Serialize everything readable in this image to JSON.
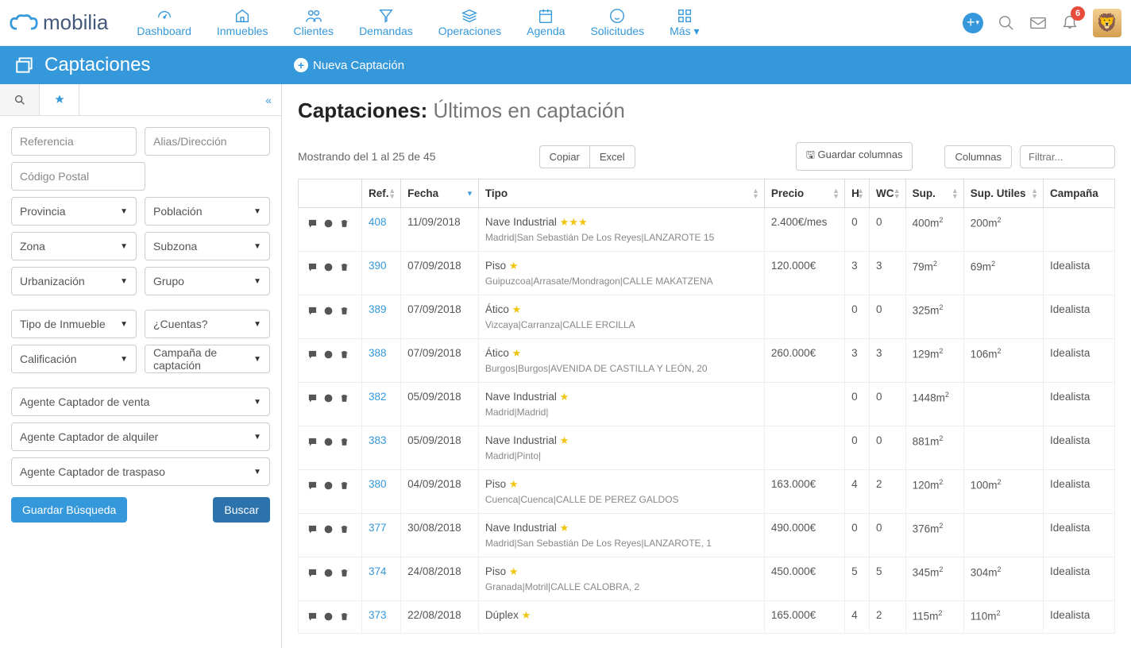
{
  "brand": "mobilia",
  "nav": {
    "items": [
      "Dashboard",
      "Inmuebles",
      "Clientes",
      "Demandas",
      "Operaciones",
      "Agenda",
      "Solicitudes",
      "Más"
    ],
    "badge": "6"
  },
  "bluebar": {
    "title": "Captaciones",
    "action": "Nueva Captación"
  },
  "filters": {
    "referencia": "Referencia",
    "alias": "Alias/Dirección",
    "cp": "Código Postal",
    "provincia": "Provincia",
    "poblacion": "Población",
    "zona": "Zona",
    "subzona": "Subzona",
    "urbanizacion": "Urbanización",
    "grupo": "Grupo",
    "tipo": "Tipo de Inmueble",
    "cuentas": "¿Cuentas?",
    "calificacion": "Calificación",
    "campana": "Campaña de captación",
    "agente_venta": "Agente Captador de venta",
    "agente_alquiler": "Agente Captador de alquiler",
    "agente_traspaso": "Agente Captador de traspaso",
    "guardar": "Guardar Búsqueda",
    "buscar": "Buscar"
  },
  "page": {
    "title_bold": "Captaciones:",
    "title_light": " Últimos en captación",
    "showing": "Mostrando del 1 al 25 de 45",
    "copiar": "Copiar",
    "excel": "Excel",
    "guardar_col": "Guardar columnas",
    "columnas": "Columnas",
    "filtrar": "Filtrar..."
  },
  "table": {
    "headers": {
      "ref": "Ref.",
      "fecha": "Fecha",
      "tipo": "Tipo",
      "precio": "Precio",
      "h": "H",
      "wc": "WC",
      "sup": "Sup.",
      "suputil": "Sup. Utiles",
      "campana": "Campaña"
    },
    "rows": [
      {
        "ref": "408",
        "fecha": "11/09/2018",
        "tipo": "Nave Industrial",
        "stars": 3,
        "sub": "Madrid|San Sebastián De Los Reyes|LANZAROTE 15",
        "precio": "2.400€/mes",
        "h": "0",
        "wc": "0",
        "sup": "400m",
        "suputil": "200m",
        "campana": ""
      },
      {
        "ref": "390",
        "fecha": "07/09/2018",
        "tipo": "Piso",
        "stars": 1,
        "sub": "Guipuzcoa|Arrasate/Mondragon|CALLE MAKATZENA",
        "precio": "120.000€",
        "h": "3",
        "wc": "3",
        "sup": "79m",
        "suputil": "69m",
        "campana": "Idealista"
      },
      {
        "ref": "389",
        "fecha": "07/09/2018",
        "tipo": "Ático",
        "stars": 1,
        "sub": "Vizcaya|Carranza|CALLE ERCILLA",
        "precio": "",
        "h": "0",
        "wc": "0",
        "sup": "325m",
        "suputil": "",
        "campana": "Idealista"
      },
      {
        "ref": "388",
        "fecha": "07/09/2018",
        "tipo": "Ático",
        "stars": 1,
        "sub": "Burgos|Burgos|AVENIDA DE CASTILLA Y LEÓN, 20",
        "precio": "260.000€",
        "h": "3",
        "wc": "3",
        "sup": "129m",
        "suputil": "106m",
        "campana": "Idealista"
      },
      {
        "ref": "382",
        "fecha": "05/09/2018",
        "tipo": "Nave Industrial",
        "stars": 1,
        "sub": "Madrid|Madrid|",
        "precio": "",
        "h": "0",
        "wc": "0",
        "sup": "1448m",
        "suputil": "",
        "campana": "Idealista"
      },
      {
        "ref": "383",
        "fecha": "05/09/2018",
        "tipo": "Nave Industrial",
        "stars": 1,
        "sub": "Madrid|Pinto|",
        "precio": "",
        "h": "0",
        "wc": "0",
        "sup": "881m",
        "suputil": "",
        "campana": "Idealista"
      },
      {
        "ref": "380",
        "fecha": "04/09/2018",
        "tipo": "Piso",
        "stars": 1,
        "sub": "Cuenca|Cuenca|CALLE DE PEREZ GALDOS",
        "precio": "163.000€",
        "h": "4",
        "wc": "2",
        "sup": "120m",
        "suputil": "100m",
        "campana": "Idealista"
      },
      {
        "ref": "377",
        "fecha": "30/08/2018",
        "tipo": "Nave Industrial",
        "stars": 1,
        "sub": "Madrid|San Sebastián De Los Reyes|LANZAROTE, 1",
        "precio": "490.000€",
        "h": "0",
        "wc": "0",
        "sup": "376m",
        "suputil": "",
        "campana": "Idealista"
      },
      {
        "ref": "374",
        "fecha": "24/08/2018",
        "tipo": "Piso",
        "stars": 1,
        "sub": "Granada|Motril|CALLE CALOBRA, 2",
        "precio": "450.000€",
        "h": "5",
        "wc": "5",
        "sup": "345m",
        "suputil": "304m",
        "campana": "Idealista"
      },
      {
        "ref": "373",
        "fecha": "22/08/2018",
        "tipo": "Dúplex",
        "stars": 1,
        "sub": "",
        "precio": "165.000€",
        "h": "4",
        "wc": "2",
        "sup": "115m",
        "suputil": "110m",
        "campana": "Idealista"
      }
    ]
  }
}
